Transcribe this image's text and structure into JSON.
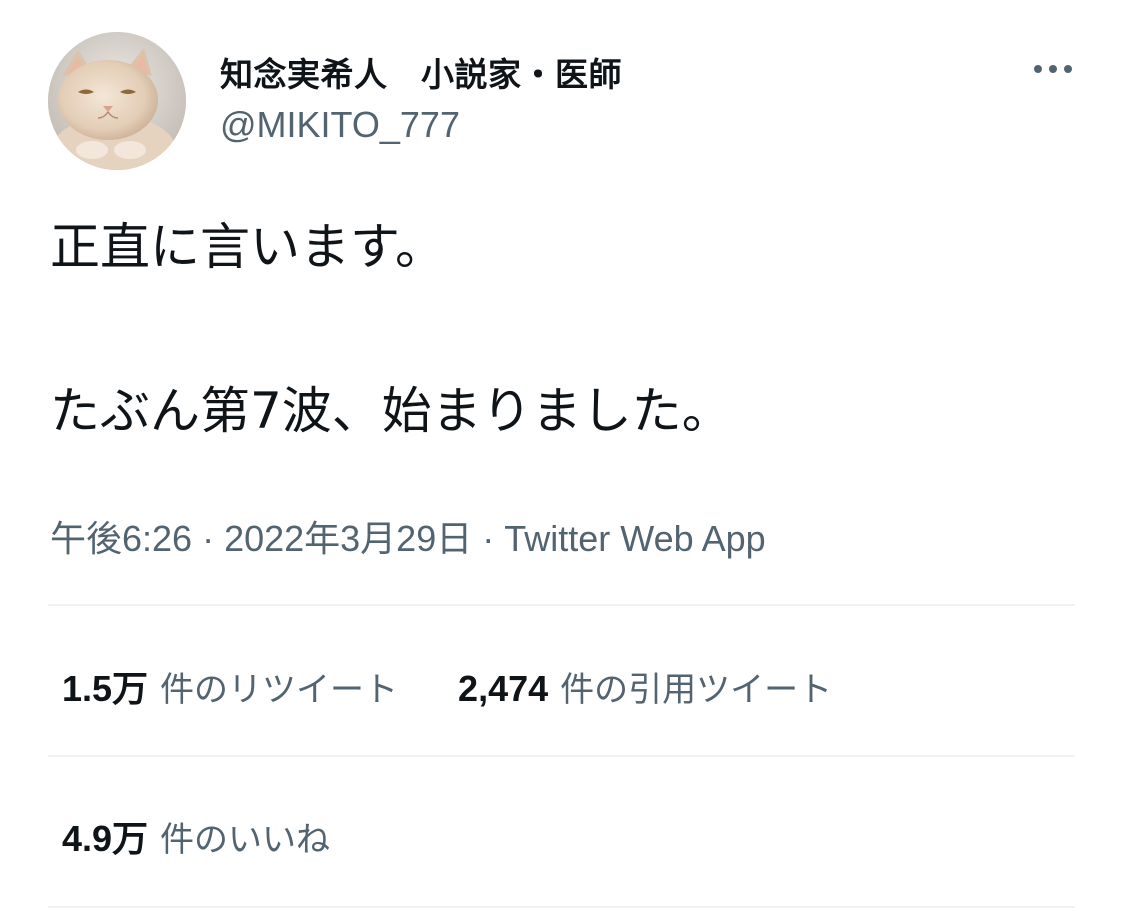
{
  "author": {
    "display_name": "知念実希人　小説家・医師",
    "handle": "@MIKITO_777",
    "avatar_icon": "cat-avatar-icon"
  },
  "menu": {
    "more_icon": "more-horizontal-icon"
  },
  "tweet": {
    "text_line1": "正直に言います。",
    "text_line2": "たぶん第7波、始まりました。"
  },
  "meta": {
    "time": "午後6:26",
    "separator": "·",
    "date": "2022年3月29日",
    "source": "Twitter Web App"
  },
  "stats": {
    "retweets": {
      "count": "1.5万",
      "label": "件のリツイート"
    },
    "quotes": {
      "count": "2,474",
      "label": "件の引用ツイート"
    },
    "likes": {
      "count": "4.9万",
      "label": "件のいいね"
    }
  },
  "colors": {
    "text_primary": "#0f1419",
    "text_secondary": "#536471",
    "divider": "#eff3f4",
    "background": "#ffffff"
  }
}
